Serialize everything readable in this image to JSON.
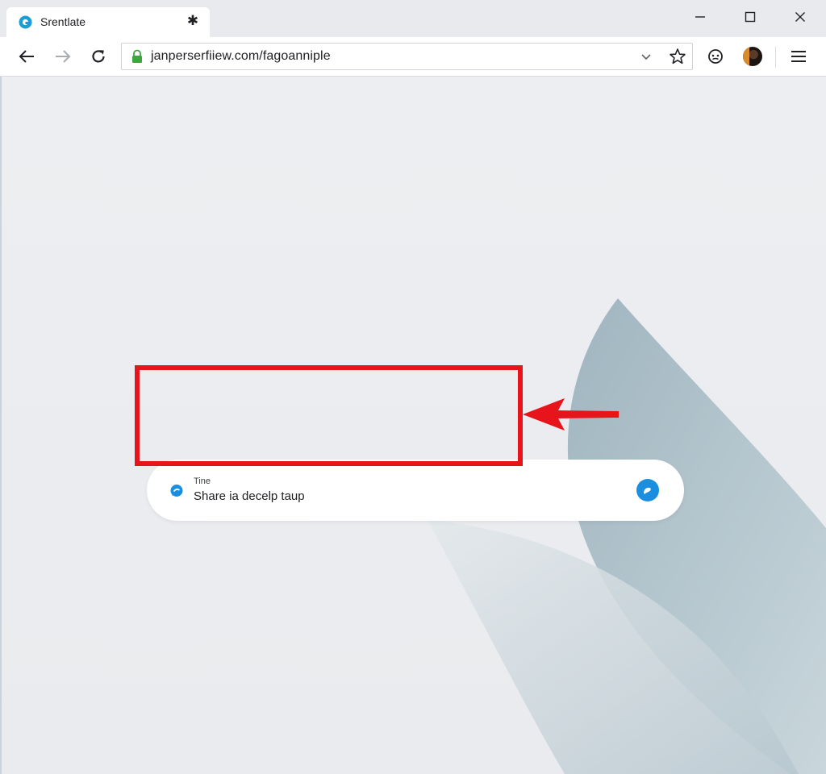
{
  "tab": {
    "title": "Srentlate",
    "favicon": "site-logo-icon",
    "close_glyph": "✱"
  },
  "window_controls": [
    "minimize-icon",
    "maximize-icon",
    "close-icon"
  ],
  "toolbar": {
    "back": "arrow-left-icon",
    "forward": "arrow-right-icon",
    "reload": "reload-icon",
    "url": "janperserfiiew.com/fagoanniple",
    "secure": "lock-icon",
    "dropdown": "chevron-down-icon",
    "bookmark": "star-icon",
    "extension": "extension-icon",
    "profile": "avatar",
    "menu": "hamburger-menu-icon"
  },
  "notification": {
    "label": "Tine",
    "text": "Share ia decelp taup",
    "icon": "chat-bubble-icon",
    "action_icon": "chat-bubble-icon",
    "accent_color": "#1a8fe0"
  },
  "annotation": {
    "box_color": "#e8141c",
    "arrow_color": "#e8141c"
  }
}
